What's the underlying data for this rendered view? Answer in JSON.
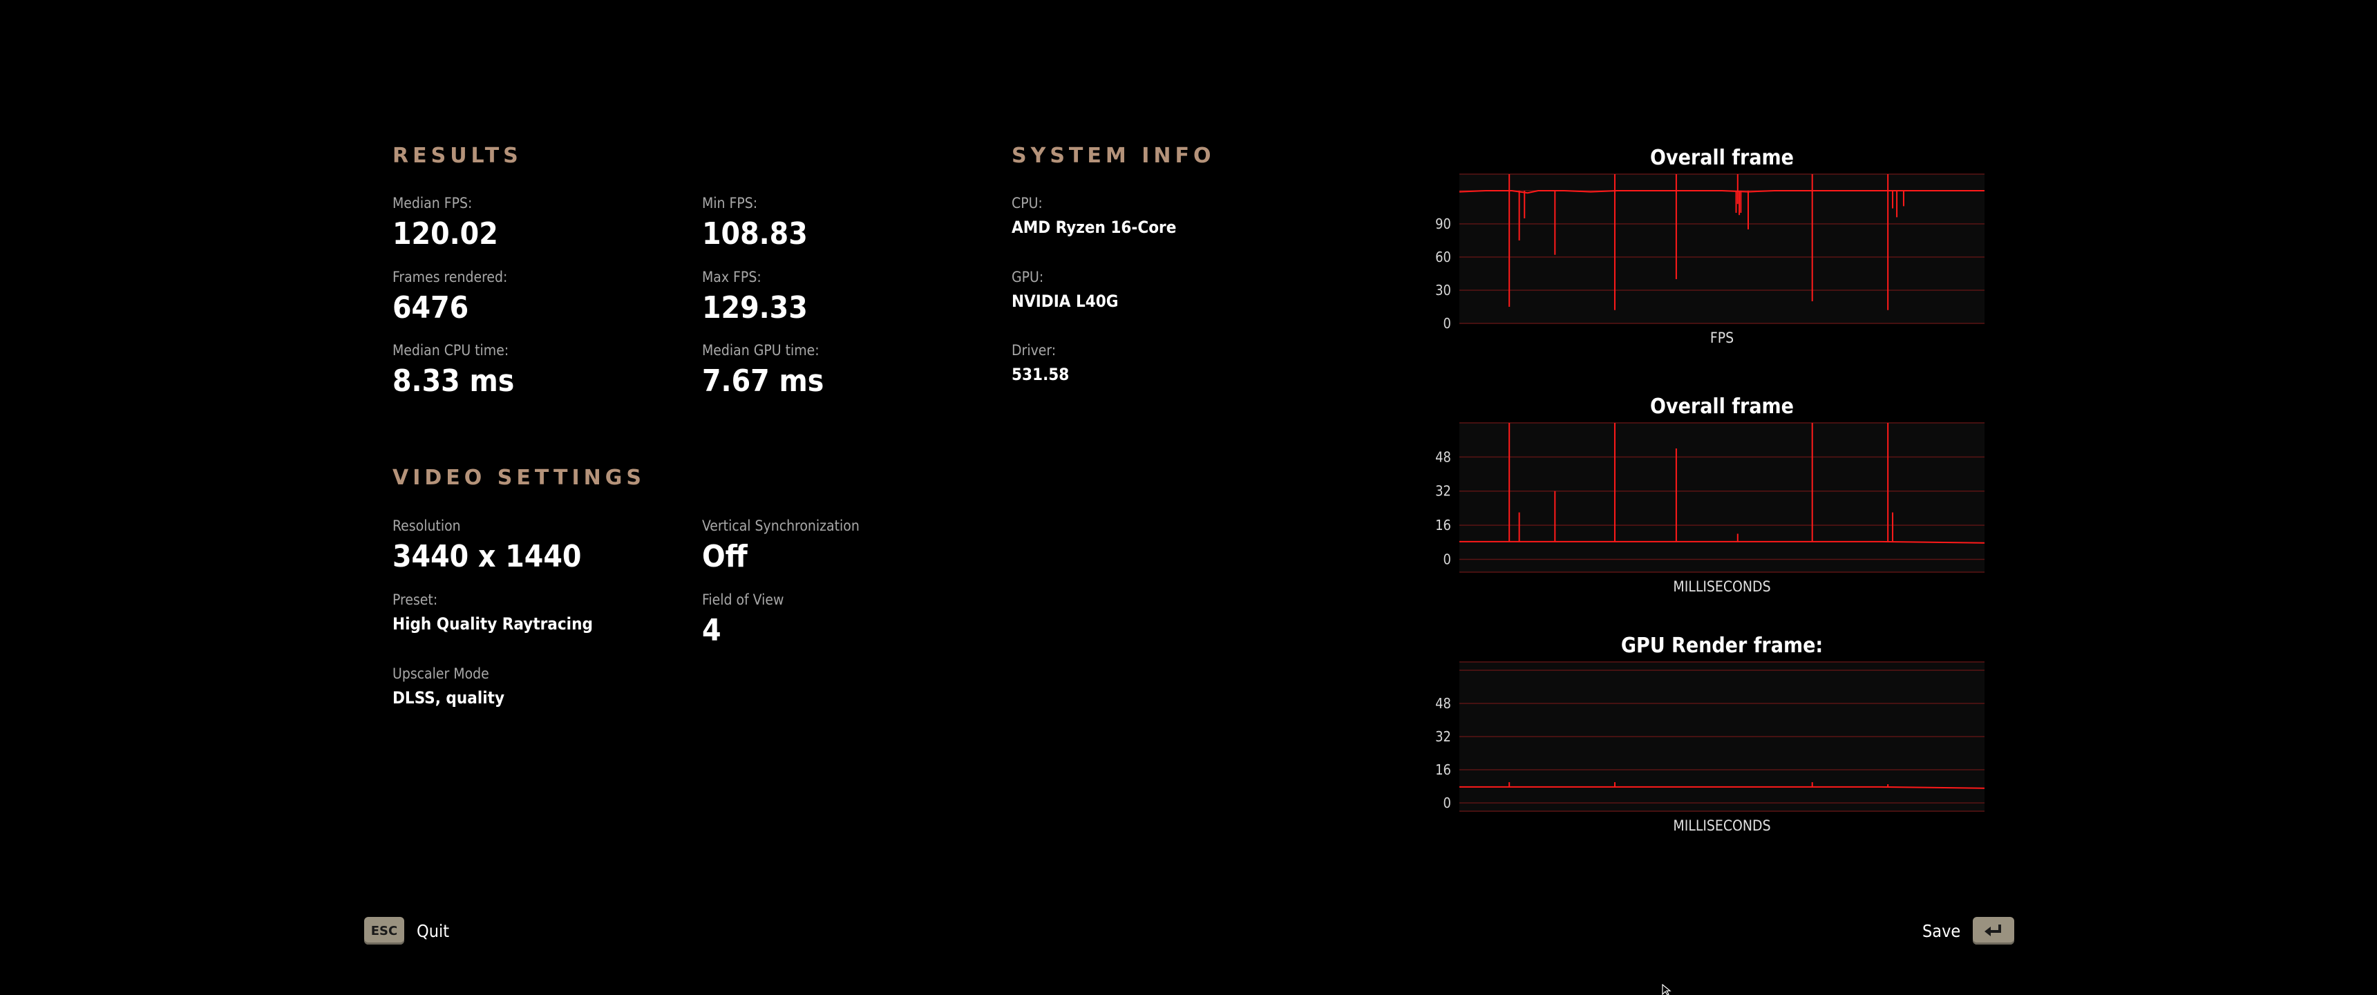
{
  "results": {
    "title": "RESULTS",
    "stats": [
      {
        "label": "Median FPS:",
        "value": "120.02"
      },
      {
        "label": "Min FPS:",
        "value": "108.83"
      },
      {
        "label": "Frames rendered:",
        "value": "6476"
      },
      {
        "label": "Max FPS:",
        "value": "129.33"
      },
      {
        "label": "Median CPU time:",
        "value": "8.33 ms"
      },
      {
        "label": "Median GPU time:",
        "value": "7.67 ms"
      }
    ]
  },
  "video_settings": {
    "title": "VIDEO SETTINGS",
    "resolution": {
      "label": "Resolution",
      "value": "3440 x 1440"
    },
    "vsync": {
      "label": "Vertical Synchronization",
      "value": "Off"
    },
    "preset": {
      "label": "Preset:",
      "value": "High Quality Raytracing"
    },
    "fov": {
      "label": "Field of View",
      "value": "4"
    },
    "upscaler": {
      "label": "Upscaler Mode",
      "value": "DLSS, quality"
    }
  },
  "system_info": {
    "title": "SYSTEM INFO",
    "cpu": {
      "label": "CPU:",
      "value": "AMD Ryzen 16-Core"
    },
    "gpu": {
      "label": "GPU:",
      "value": "NVIDIA L40G"
    },
    "driver": {
      "label": "Driver:",
      "value": "531.58"
    }
  },
  "colors": {
    "accent": "#b5937a",
    "line": "#ff1a1a",
    "grid": "#5a1414"
  },
  "chart_data": [
    {
      "type": "line",
      "title": "Overall frame",
      "xlabel": "FPS",
      "yticks": [
        0,
        30,
        60,
        90
      ],
      "ylim": [
        0,
        135
      ],
      "x": [
        0,
        5,
        10,
        13,
        15,
        16,
        20,
        25,
        30,
        35,
        40,
        45,
        50,
        55,
        60,
        65,
        70,
        75,
        80,
        85,
        90,
        95,
        100
      ],
      "values": [
        119,
        120,
        120,
        118,
        120,
        120,
        120,
        119,
        120,
        120,
        120,
        120,
        120,
        119,
        120,
        120,
        120,
        120,
        120,
        120,
        120,
        120,
        120
      ],
      "spikes": [
        {
          "x": 9.5,
          "min": 15
        },
        {
          "x": 11.4,
          "min": 75
        },
        {
          "x": 12.4,
          "min": 95
        },
        {
          "x": 18.2,
          "min": 62
        },
        {
          "x": 29.6,
          "min": 12
        },
        {
          "x": 41.3,
          "min": 40
        },
        {
          "x": 52.7,
          "min": 100
        },
        {
          "x": 53.0,
          "min": 108
        },
        {
          "x": 53.3,
          "min": 98
        },
        {
          "x": 53.6,
          "min": 100
        },
        {
          "x": 55.0,
          "min": 85
        },
        {
          "x": 67.2,
          "min": 20
        },
        {
          "x": 81.6,
          "min": 12
        },
        {
          "x": 82.5,
          "min": 104
        },
        {
          "x": 83.3,
          "min": 96
        },
        {
          "x": 84.6,
          "min": 106
        }
      ],
      "ceiling_x": [
        9.5,
        29.6,
        41.3,
        53.0,
        67.2,
        81.6
      ],
      "xlim": [
        0,
        100
      ]
    },
    {
      "type": "line",
      "title": "Overall frame",
      "xlabel": "MILLISECONDS",
      "yticks": [
        0,
        16,
        32,
        48
      ],
      "ylim": [
        -6,
        64
      ],
      "baseline": 8.3,
      "spikes": [
        {
          "x": 9.5,
          "max": 64
        },
        {
          "x": 11.4,
          "max": 22
        },
        {
          "x": 18.2,
          "max": 32
        },
        {
          "x": 29.6,
          "max": 64
        },
        {
          "x": 41.3,
          "max": 52
        },
        {
          "x": 53.0,
          "max": 12
        },
        {
          "x": 67.2,
          "max": 64
        },
        {
          "x": 81.6,
          "max": 64
        },
        {
          "x": 82.5,
          "max": 22
        }
      ],
      "xlim": [
        0,
        100
      ]
    },
    {
      "type": "line",
      "title": "GPU Render frame:",
      "xlabel": "MILLISECONDS",
      "yticks": [
        0,
        16,
        32,
        48
      ],
      "ylim": [
        -4,
        68
      ],
      "baseline": 7.7,
      "bumps": [
        {
          "x": 9.5,
          "max": 10
        },
        {
          "x": 29.6,
          "max": 10
        },
        {
          "x": 67.2,
          "max": 10
        },
        {
          "x": 81.6,
          "max": 9
        }
      ],
      "xlim": [
        0,
        100
      ]
    }
  ],
  "footer": {
    "quit_key": "ESC",
    "quit_label": "Quit",
    "save_label": "Save",
    "save_key_icon": "enter-icon"
  }
}
